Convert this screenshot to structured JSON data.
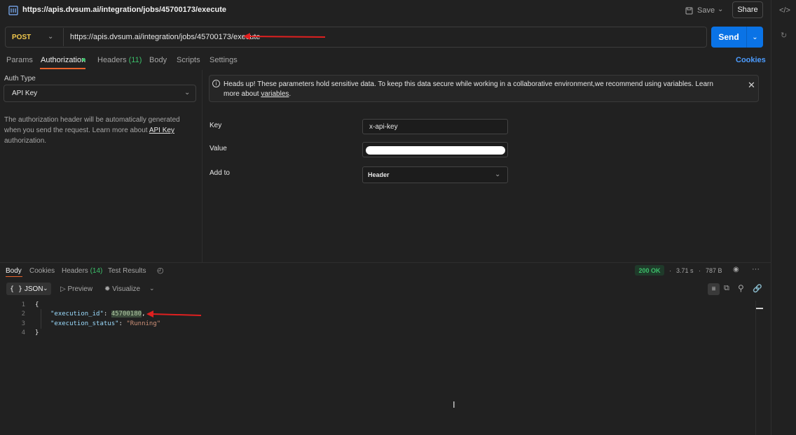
{
  "header": {
    "title": "https://apis.dvsum.ai/integration/jobs/45700173/execute",
    "save_label": "Save",
    "share_label": "Share"
  },
  "request": {
    "method": "POST",
    "url": "https://apis.dvsum.ai/integration/jobs/45700173/execute",
    "send_label": "Send"
  },
  "tabs": {
    "params": "Params",
    "authorization": "Authorization",
    "headers": "Headers",
    "headers_count": "(11)",
    "body": "Body",
    "scripts": "Scripts",
    "settings": "Settings",
    "cookies": "Cookies"
  },
  "auth": {
    "type_label": "Auth Type",
    "type_value": "API Key",
    "desc_pre": "The authorization header will be automatically generated when you send the request. Learn more about ",
    "desc_link": "API Key",
    "desc_post": " authorization."
  },
  "banner": {
    "text": "Heads up! These parameters hold sensitive data. To keep this data secure while working in a collaborative environment,we recommend using variables. Learn more about ",
    "link": "variables",
    "end": "."
  },
  "fields": {
    "key_label": "Key",
    "key_value": "x-api-key",
    "value_label": "Value",
    "addto_label": "Add to",
    "addto_value": "Header"
  },
  "response": {
    "tabs": {
      "body": "Body",
      "cookies": "Cookies",
      "headers": "Headers",
      "headers_count": "(14)",
      "tests": "Test Results"
    },
    "status": "200 OK",
    "time": "3.71 s",
    "size": "787 B",
    "format": "JSON",
    "preview": "Preview",
    "visualize": "Visualize",
    "code_lines": {
      "l1": "{",
      "l2_key": "\"execution_id\"",
      "l2_val": "45700180",
      "l3_key": "\"execution_status\"",
      "l3_val": "\"Running\"",
      "l4": "}"
    },
    "line_numbers": [
      "1",
      "2",
      "3",
      "4"
    ]
  }
}
